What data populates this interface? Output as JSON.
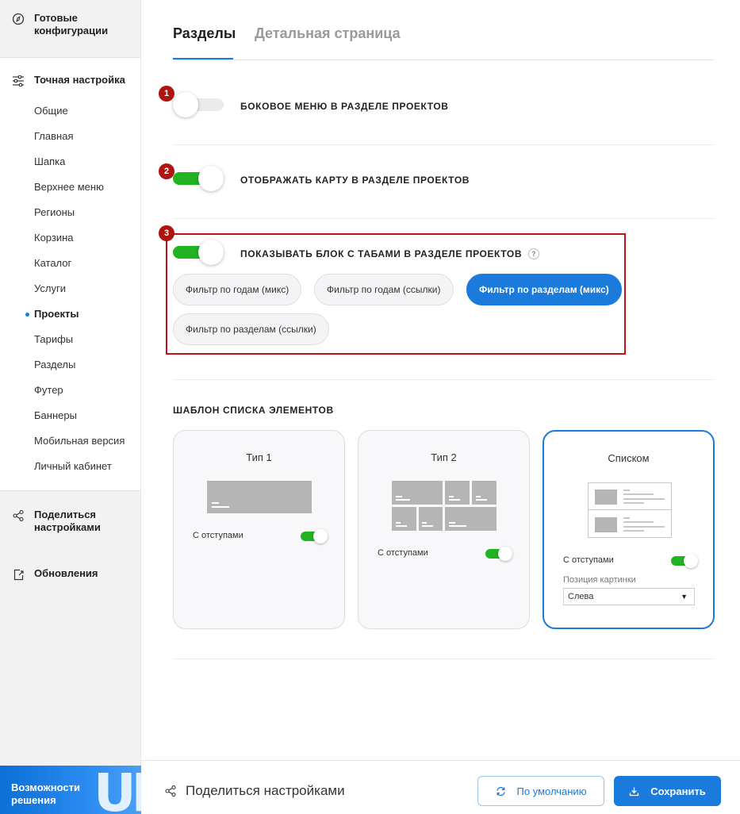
{
  "sidebar": {
    "ready_configs": "Готовые конфигурации",
    "fine_tune": "Точная настройка",
    "items": [
      {
        "label": "Общие"
      },
      {
        "label": "Главная"
      },
      {
        "label": "Шапка"
      },
      {
        "label": "Верхнее меню"
      },
      {
        "label": "Регионы"
      },
      {
        "label": "Корзина"
      },
      {
        "label": "Каталог"
      },
      {
        "label": "Услуги"
      },
      {
        "label": "Проекты",
        "active": true
      },
      {
        "label": "Тарифы"
      },
      {
        "label": "Разделы"
      },
      {
        "label": "Футер"
      },
      {
        "label": "Баннеры"
      },
      {
        "label": "Мобильная версия"
      },
      {
        "label": "Личный кабинет"
      }
    ],
    "share": "Поделиться настройками",
    "updates": "Обновления",
    "promo": "Возможности решения"
  },
  "tabs": [
    {
      "label": "Разделы",
      "active": true
    },
    {
      "label": "Детальная страница",
      "active": false
    }
  ],
  "settings": [
    {
      "badge": "1",
      "label": "БОКОВОЕ МЕНЮ В РАЗДЕЛЕ ПРОЕКТОВ",
      "enabled": false
    },
    {
      "badge": "2",
      "label": "ОТОБРАЖАТЬ КАРТУ В РАЗДЕЛЕ ПРОЕКТОВ",
      "enabled": true
    },
    {
      "badge": "3",
      "label": "ПОКАЗЫВАТЬ БЛОК С ТАБАМИ В РАЗДЕЛЕ ПРОЕКТОВ",
      "enabled": true,
      "help": "?"
    }
  ],
  "tab_filters": [
    {
      "label": "Фильтр по годам (микс)",
      "selected": false
    },
    {
      "label": "Фильтр по годам (ссылки)",
      "selected": false
    },
    {
      "label": "Фильтр по разделам (микс)",
      "selected": true
    },
    {
      "label": "Фильтр по разделам (ссылки)",
      "selected": false
    }
  ],
  "template": {
    "title": "ШАБЛОН СПИСКА ЭЛЕМЕНТОВ",
    "cards": [
      {
        "title": "Тип 1",
        "option": "С отступами",
        "option_on": true
      },
      {
        "title": "Тип 2",
        "option": "С отступами",
        "option_on": true
      },
      {
        "title": "Списком",
        "option": "С отступами",
        "option_on": true,
        "selected": true,
        "image_position_label": "Позиция картинки",
        "image_position_value": "Слева"
      }
    ]
  },
  "footer": {
    "share": "Поделиться настройками",
    "default_button": "По умолчанию",
    "save_button": "Сохранить"
  },
  "colors": {
    "accent": "#1a7bdc",
    "toggle_on": "#22b322",
    "badge": "#b0140f",
    "highlight_border": "#c0141a"
  }
}
